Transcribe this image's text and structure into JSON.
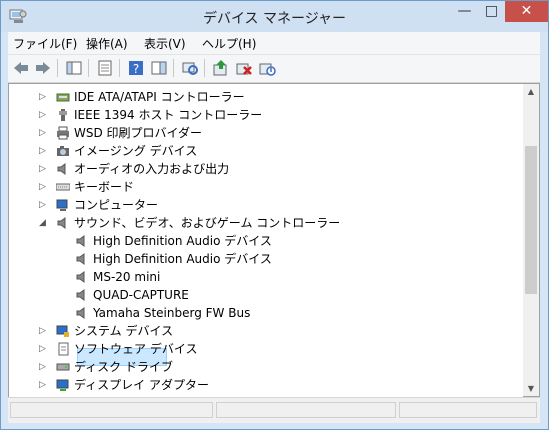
{
  "window": {
    "title": "デバイス マネージャー",
    "min": "—",
    "max": "□",
    "close": "✕"
  },
  "menu": [
    "ファイル(F)",
    "操作(A)",
    "表示(V)",
    "ヘルプ(H)"
  ],
  "toolbar": {
    "icons": [
      "back-arrow-icon",
      "forward-arrow-icon",
      "show-hide-console-tree-icon",
      "properties-icon",
      "help-icon",
      "action-pane-icon",
      "scan-hardware-icon",
      "update-driver-icon",
      "uninstall-icon",
      "enable-device-icon"
    ]
  },
  "tree": {
    "items": [
      {
        "label": "IDE ATA/ATAPI コントローラー",
        "level": 0,
        "arrow": "▷",
        "icon": "ide-controller-icon"
      },
      {
        "label": "IEEE 1394 ホスト コントローラー",
        "level": 0,
        "arrow": "▷",
        "icon": "ieee1394-icon"
      },
      {
        "label": "WSD 印刷プロバイダー",
        "level": 0,
        "arrow": "▷",
        "icon": "printer-icon"
      },
      {
        "label": "イメージング デバイス",
        "level": 0,
        "arrow": "▷",
        "icon": "camera-icon"
      },
      {
        "label": "オーディオの入力および出力",
        "level": 0,
        "arrow": "▷",
        "icon": "speaker-icon"
      },
      {
        "label": "キーボード",
        "level": 0,
        "arrow": "▷",
        "icon": "keyboard-icon"
      },
      {
        "label": "コンピューター",
        "level": 0,
        "arrow": "▷",
        "icon": "computer-icon"
      },
      {
        "label": "サウンド、ビデオ、およびゲーム コントローラー",
        "level": 0,
        "arrow": "◢",
        "icon": "speaker-icon"
      },
      {
        "label": "High Definition Audio デバイス",
        "level": 1,
        "arrow": "",
        "icon": "speaker-icon"
      },
      {
        "label": "High Definition Audio デバイス",
        "level": 1,
        "arrow": "",
        "icon": "speaker-icon"
      },
      {
        "label": "MS-20 mini",
        "level": 1,
        "arrow": "",
        "icon": "speaker-icon",
        "selected": true
      },
      {
        "label": "QUAD-CAPTURE",
        "level": 1,
        "arrow": "",
        "icon": "speaker-icon"
      },
      {
        "label": "Yamaha Steinberg FW Bus",
        "level": 1,
        "arrow": "",
        "icon": "speaker-icon"
      },
      {
        "label": "システム デバイス",
        "level": 0,
        "arrow": "▷",
        "icon": "system-device-icon"
      },
      {
        "label": "ソフトウェア デバイス",
        "level": 0,
        "arrow": "▷",
        "icon": "software-device-icon"
      },
      {
        "label": "ディスク ドライブ",
        "level": 0,
        "arrow": "▷",
        "icon": "disk-drive-icon"
      },
      {
        "label": "ディスプレイ アダプター",
        "level": 0,
        "arrow": "▷",
        "icon": "display-adapter-icon"
      }
    ]
  },
  "scrollbar": {
    "up": "▲",
    "down": "▼"
  },
  "colors": {
    "title_bg": "#cfe0f3",
    "close_bg": "#c7504b",
    "selection": "#cce8ff"
  }
}
